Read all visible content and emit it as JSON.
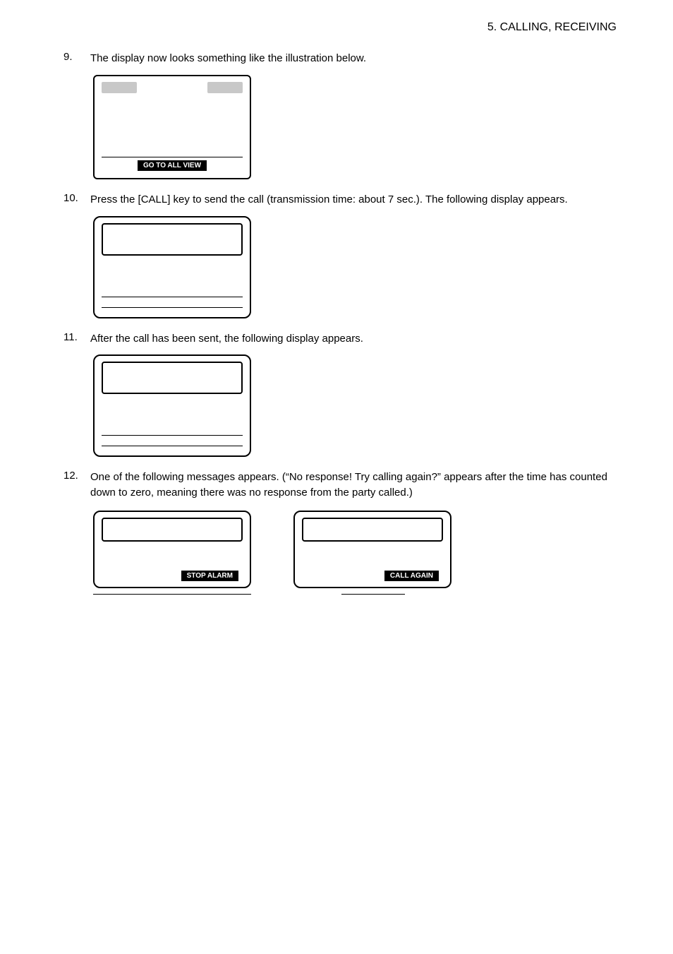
{
  "header": "5.  CALLING,  RECEIVING",
  "items": {
    "i9": {
      "num": "9.",
      "text": "The display now looks something like the illustration below."
    },
    "i10": {
      "num": "10.",
      "text": "Press the [CALL] key to send the call (transmission time: about 7 sec.). The following display appears."
    },
    "i11": {
      "num": "11.",
      "text": "After the call has been sent, the following display appears."
    },
    "i12": {
      "num": "12.",
      "text": "One of the following messages appears. (“No response! Try calling again?” appears after the time has counted down to zero, meaning there was no response from the party called.)"
    }
  },
  "buttons": {
    "go_all_view": "GO TO ALL VIEW",
    "stop_alarm": "STOP ALARM",
    "call_again": "CALL AGAIN"
  }
}
